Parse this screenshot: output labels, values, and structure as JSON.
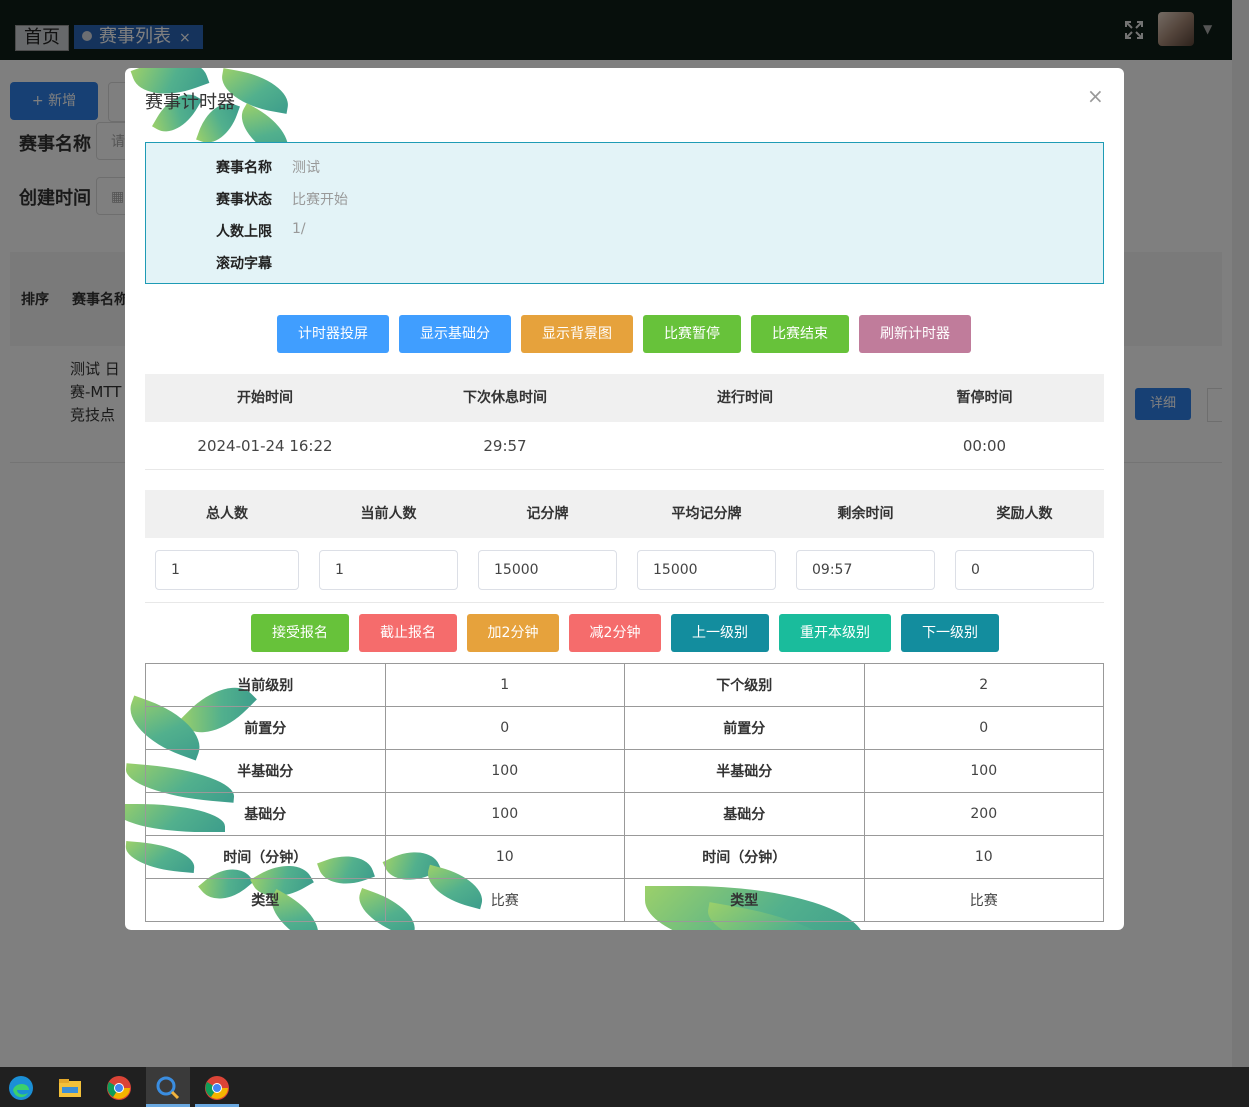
{
  "nav": {
    "tab_home": "首页",
    "tab_active": "赛事列表",
    "tab_close": "×"
  },
  "page": {
    "add_button": "+ 新增",
    "filter_name_label": "赛事名称",
    "filter_name_placeholder": "请",
    "filter_time_label": "创建时间",
    "col_order": "排序",
    "col_name": "赛事名称",
    "row_name": "测试 日赛-MTT 竞技点",
    "detail_button": "详细"
  },
  "modal": {
    "title": "赛事计时器",
    "close": "×",
    "info": {
      "name_label": "赛事名称",
      "name_value": "测试",
      "status_label": "赛事状态",
      "status_value": "比赛开始",
      "limit_label": "人数上限",
      "limit_value": "1/",
      "marquee_label": "滚动字幕",
      "marquee_value": ""
    },
    "actions": {
      "projection": "计时器投屏",
      "show_base": "显示基础分",
      "show_bg": "显示背景图",
      "pause": "比赛暂停",
      "end": "比赛结束",
      "refresh": "刷新计时器"
    },
    "timing": {
      "headers": [
        "开始时间",
        "下次休息时间",
        "进行时间",
        "暂停时间"
      ],
      "values": [
        "2024-01-24 16:22",
        "29:57",
        "",
        "00:00"
      ]
    },
    "stats": {
      "headers": [
        "总人数",
        "当前人数",
        "记分牌",
        "平均记分牌",
        "剩余时间",
        "奖励人数"
      ],
      "values": [
        "1",
        "1",
        "15000",
        "15000",
        "09:57",
        "0"
      ]
    },
    "controls": {
      "accept": "接受报名",
      "close_reg": "截止报名",
      "add2": "加2分钟",
      "sub2": "减2分钟",
      "prev": "上一级别",
      "restart": "重开本级别",
      "next": "下一级别"
    },
    "levels": [
      [
        "当前级别",
        "1",
        "下个级别",
        "2"
      ],
      [
        "前置分",
        "0",
        "前置分",
        "0"
      ],
      [
        "半基础分",
        "100",
        "半基础分",
        "100"
      ],
      [
        "基础分",
        "100",
        "基础分",
        "200"
      ],
      [
        "时间（分钟）",
        "10",
        "时间（分钟）",
        "10"
      ],
      [
        "类型",
        "比赛",
        "类型",
        "比赛"
      ]
    ]
  },
  "colors": {
    "blue": "#409eff",
    "orange": "#e6a23c",
    "green": "#67c23a",
    "pink": "#c07c9b",
    "red": "#f56c6c",
    "teal": "#138d9e",
    "cyan": "#1abc9c",
    "info_bg": "#e3f3f7"
  },
  "icons": [
    "fullscreen-icon",
    "avatar",
    "caret-down-icon",
    "edge-icon",
    "file-explorer-icon",
    "chrome-icon",
    "search-app-icon",
    "chrome-icon"
  ]
}
